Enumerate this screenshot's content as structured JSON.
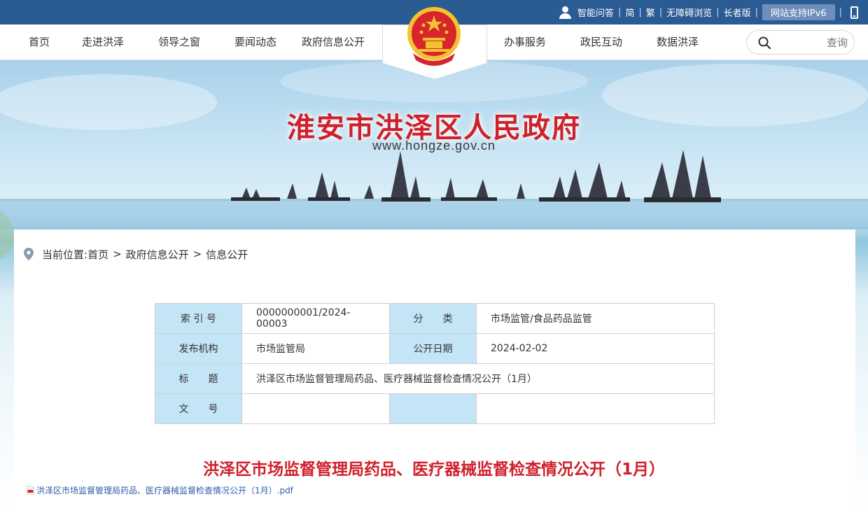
{
  "topbar": {
    "links": [
      "智能问答",
      "简",
      "繁",
      "无障碍浏览",
      "长者版"
    ],
    "ipv6_label": "网站支持IPv6"
  },
  "nav": {
    "left_items": [
      "首页",
      "走进洪泽",
      "领导之窗",
      "要闻动态",
      "政府信息公开"
    ],
    "right_items": [
      "办事服务",
      "政民互动",
      "数据洪泽"
    ],
    "search_placeholder": "查询"
  },
  "banner": {
    "site_title": "淮安市洪泽区人民政府",
    "site_url": "www.hongze.gov.cn"
  },
  "breadcrumb": {
    "prefix": "当前位置:",
    "items": [
      "首页",
      "政府信息公开",
      "信息公开"
    ],
    "separator": ">"
  },
  "meta_table": {
    "rows": [
      {
        "label1": "索 引 号",
        "value1": "0000000001/2024-00003",
        "label2": "分　　类",
        "value2": "市场监管/食品药品监管"
      },
      {
        "label1": "发布机构",
        "value1": "市场监管局",
        "label2": "公开日期",
        "value2": "2024-02-02"
      },
      {
        "label1": "标　　题",
        "value1": "洪泽区市场监督管理局药品、医疗器械监督检查情况公开（1月）"
      },
      {
        "label1": "文　　号",
        "value1": "",
        "label2": "",
        "value2": ""
      }
    ]
  },
  "document": {
    "title": "洪泽区市场监督管理局药品、医疗器械监督检查情况公开（1月）",
    "attachment": "洪泽区市场监督管理局药品、医疗器械监督检查情况公开（1月）.pdf"
  },
  "colors": {
    "topbar": "#2b5b93",
    "title_red": "#d0202a",
    "label_bg": "#c4e5f6",
    "link_blue": "#2d5ea8"
  }
}
